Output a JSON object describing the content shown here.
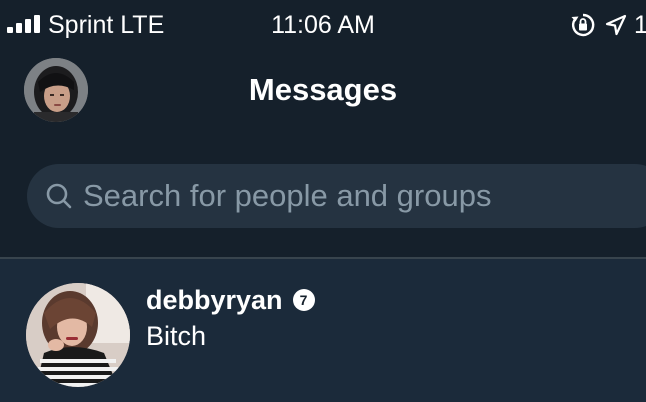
{
  "status_bar": {
    "carrier": "Sprint LTE",
    "time": "11:06 AM",
    "battery": "1",
    "icons": [
      "signal-bars-icon",
      "orientation-lock-icon",
      "location-arrow-icon"
    ]
  },
  "header": {
    "title": "Messages",
    "avatar_icon": "profile-avatar"
  },
  "search": {
    "placeholder": "Search for people and groups",
    "value": ""
  },
  "conversations": [
    {
      "name": "debbyryan",
      "badge": "7",
      "preview": "Bitch"
    }
  ],
  "colors": {
    "background": "#15202b",
    "search_bg": "#253341",
    "placeholder": "#8899a6",
    "selected_row": "#1b2a3a",
    "divider": "#38444d",
    "text": "#ffffff"
  }
}
